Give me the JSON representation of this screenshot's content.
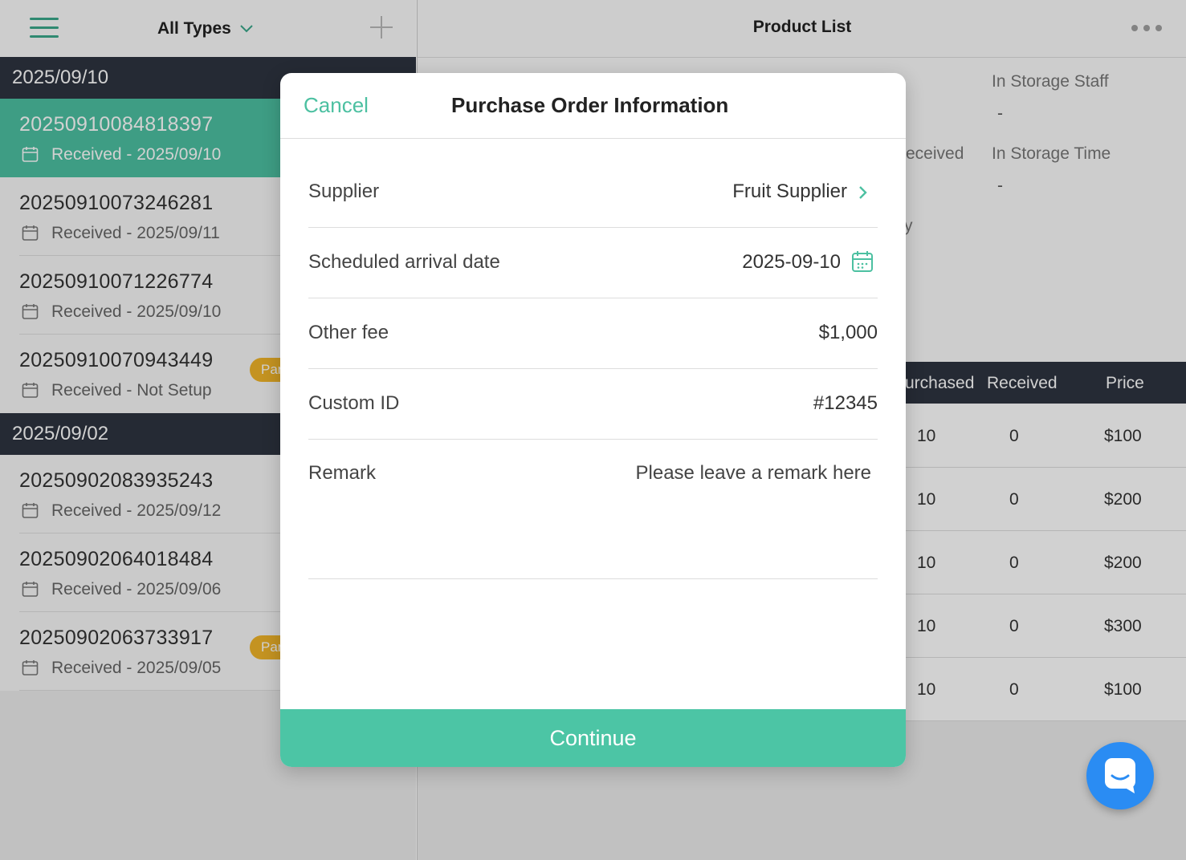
{
  "left": {
    "filter_label": "All Types",
    "groups": [
      {
        "date": "2025/09/10",
        "orders": [
          {
            "id": "20250910084818397",
            "status": "Received - 2025/09/10",
            "badge": ""
          },
          {
            "id": "20250910073246281",
            "status": "Received - 2025/09/11",
            "badge": ""
          },
          {
            "id": "20250910071226774",
            "status": "Received - 2025/09/10",
            "badge": ""
          },
          {
            "id": "20250910070943449",
            "status": "Received - Not Setup",
            "badge": "Par"
          }
        ]
      },
      {
        "date": "2025/09/02",
        "orders": [
          {
            "id": "20250902083935243",
            "status": "Received - 2025/09/12",
            "badge": ""
          },
          {
            "id": "20250902064018484",
            "status": "Received - 2025/09/06",
            "badge": ""
          },
          {
            "id": "20250902063733917",
            "status": "Received - 2025/09/05",
            "badge": "Par"
          }
        ]
      }
    ]
  },
  "right": {
    "title": "Product List",
    "in_storage_staff_label": "In Storage Staff",
    "in_storage_staff_value": "-",
    "received_label_partial": "eceived",
    "in_storage_time_label": "In Storage Time",
    "in_storage_time_value": "-",
    "partial_glyph": "y",
    "table": {
      "headers": {
        "purchased": "urchased",
        "received": "Received",
        "price": "Price"
      },
      "rows": [
        {
          "purchased": "10",
          "received": "0",
          "price": "$100"
        },
        {
          "purchased": "10",
          "received": "0",
          "price": "$200"
        },
        {
          "purchased": "10",
          "received": "0",
          "price": "$200"
        },
        {
          "purchased": "10",
          "received": "0",
          "price": "$300"
        },
        {
          "purchased": "10",
          "received": "0",
          "price": "$100"
        }
      ]
    }
  },
  "modal": {
    "cancel_label": "Cancel",
    "title": "Purchase Order Information",
    "supplier": {
      "label": "Supplier",
      "value": "Fruit Supplier"
    },
    "arrival": {
      "label": "Scheduled arrival date",
      "value": "2025-09-10"
    },
    "other_fee": {
      "label": "Other fee",
      "value": "$1,000"
    },
    "custom_id": {
      "label": "Custom ID",
      "value": "#12345"
    },
    "remark": {
      "label": "Remark",
      "placeholder": "Please leave a remark here"
    },
    "continue_label": "Continue"
  },
  "colors": {
    "accent": "#4cc0a1",
    "header_dark": "#2e3440",
    "badge": "#f0b429",
    "chat": "#2a8cf3"
  }
}
